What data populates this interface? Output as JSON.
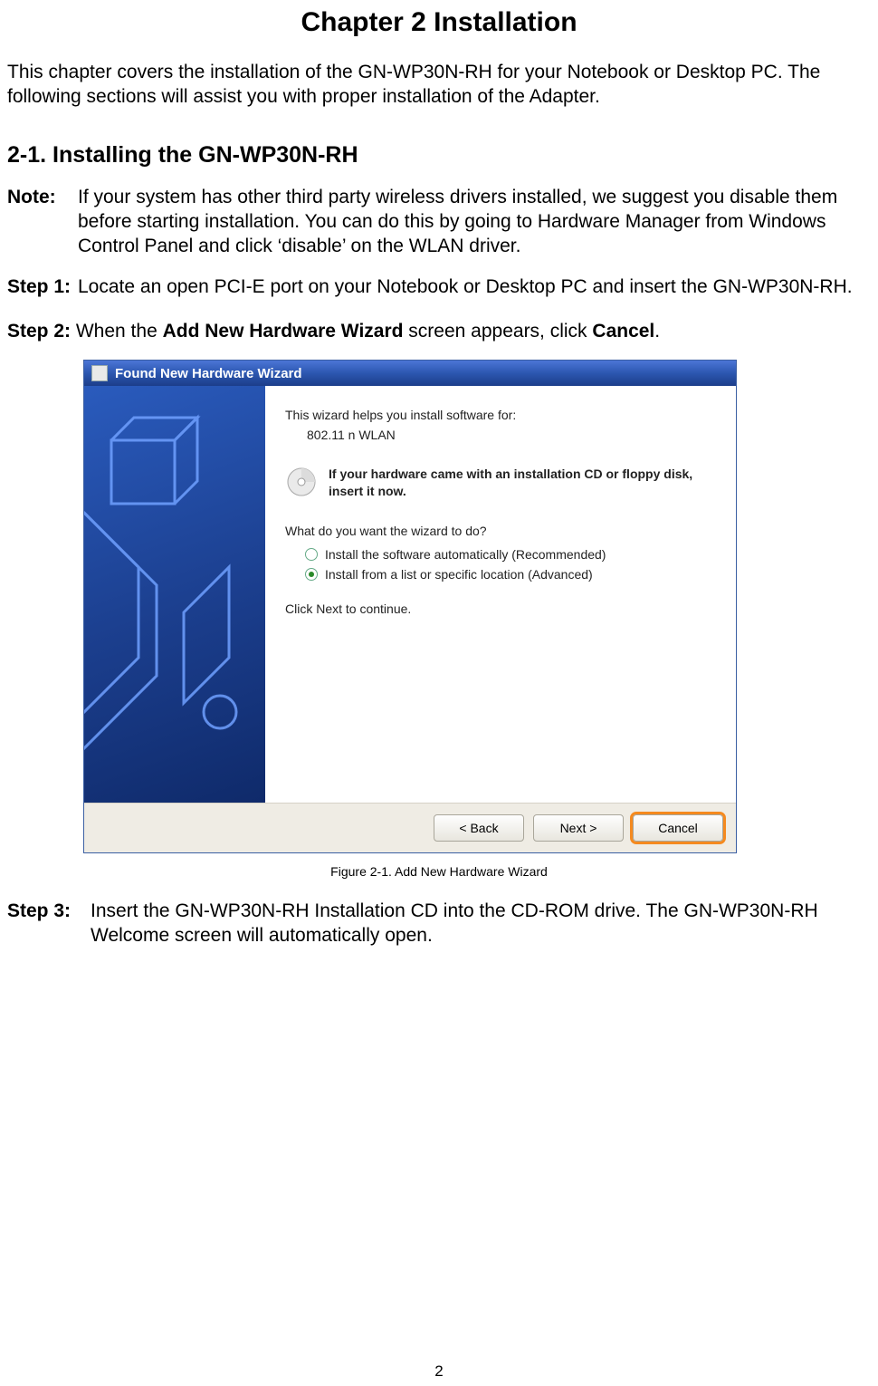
{
  "title": "Chapter 2    Installation",
  "intro": "This chapter covers the installation of the GN-WP30N-RH for your Notebook or Desktop PC. The following sections will assist you with proper installation of the Adapter.",
  "section_heading": "2-1.  Installing the GN-WP30N-RH",
  "note": {
    "label": "Note:",
    "text": "If your system has other third party wireless drivers installed, we suggest you disable them before starting installation. You can do this by going to Hardware Manager from Windows Control Panel and click ‘disable’ on the WLAN driver."
  },
  "step1": {
    "label": "Step 1:",
    "text": "Locate an open PCI-E port on your Notebook or Desktop PC and insert the GN-WP30N-RH."
  },
  "step2": {
    "label": "Step 2:",
    "pre": "When the ",
    "bold1": "Add New Hardware Wizard",
    "mid": " screen appears, click ",
    "bold2": "Cancel",
    "post": "."
  },
  "wizard": {
    "title": "Found New Hardware Wizard",
    "line1": "This wizard helps you install software for:",
    "device": "802.11 n WLAN",
    "cd_text": "If your hardware came with an installation CD or floppy disk, insert it now.",
    "prompt": "What do you want the wizard to do?",
    "opt1": "Install the software automatically (Recommended)",
    "opt2": "Install from a list or specific location (Advanced)",
    "click_next": "Click Next to continue.",
    "back": "< Back",
    "next": "Next >",
    "cancel": "Cancel"
  },
  "caption": "Figure 2-1. Add New Hardware Wizard",
  "step3": {
    "label": "Step 3:",
    "text": "Insert the GN-WP30N-RH Installation CD into the CD-ROM drive. The GN-WP30N-RH Welcome screen will automatically open."
  },
  "page_number": "2"
}
